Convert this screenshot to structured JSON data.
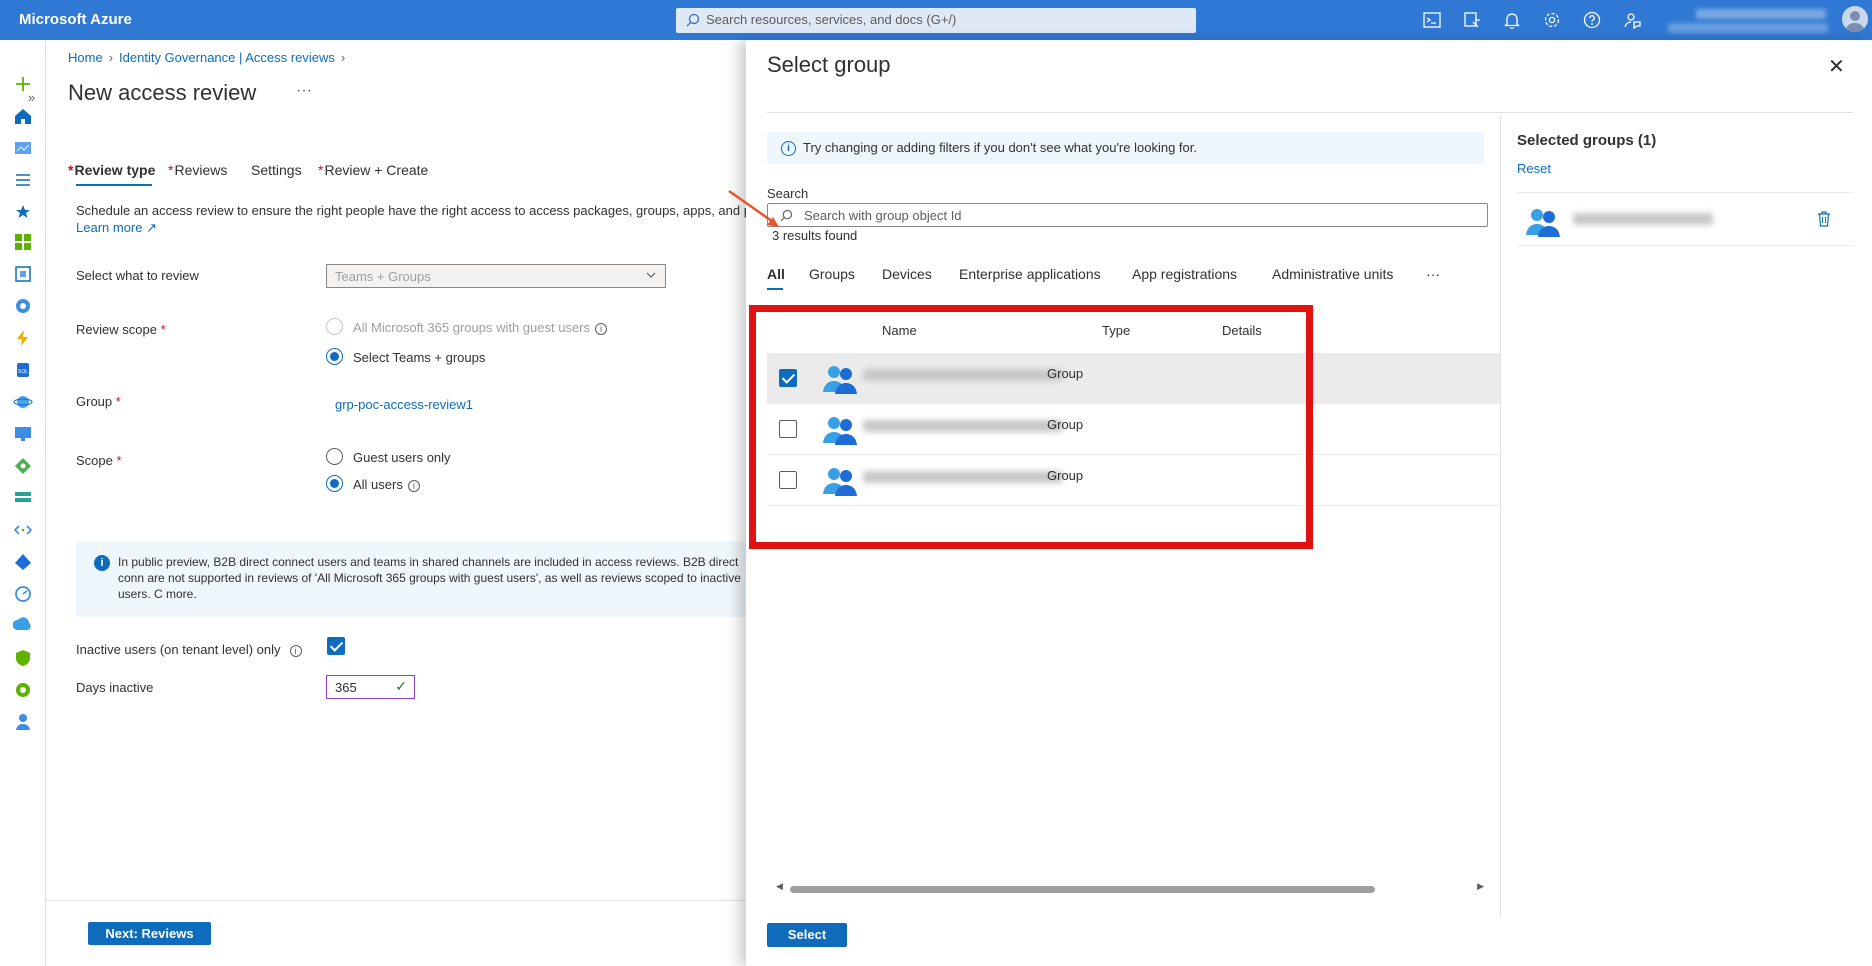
{
  "topbar": {
    "brand": "Microsoft Azure",
    "search_placeholder": "Search resources, services, and docs (G+/)",
    "icons": [
      "cloud-shell-icon",
      "directory-filter-icon",
      "notifications-icon",
      "settings-icon",
      "help-icon",
      "feedback-icon"
    ]
  },
  "breadcrumb": {
    "home": "Home",
    "parent": "Identity Governance | Access reviews"
  },
  "page": {
    "title": "New access review",
    "more": "···"
  },
  "tabs": [
    {
      "label": "Review type",
      "required": "*"
    },
    {
      "label": "Reviews",
      "required": "*"
    },
    {
      "label": "Settings",
      "required": ""
    },
    {
      "label": "Review + Create",
      "required": "*"
    }
  ],
  "form": {
    "description": "Schedule an access review to ensure the right people have the right access to access packages, groups, apps, and priv",
    "learn_more": "Learn more",
    "select_label": "Select what to review",
    "select_value": "Teams + Groups",
    "scope_label": "Review scope",
    "required_mark": "*",
    "scope_opt1": "All Microsoft 365 groups with guest users",
    "scope_opt2": "Select Teams + groups",
    "group_label": "Group",
    "group_value": "grp-poc-access-review1",
    "users_scope_label": "Scope",
    "users_opt1": "Guest users only",
    "users_opt2": "All users",
    "info_text": "In public preview, B2B direct connect users and teams in shared channels are included in access reviews. B2B direct conn are not supported in reviews of 'All Microsoft 365 groups with guest users', as well as reviews scoped to inactive users. C more.",
    "inactive_label": "Inactive users (on tenant level) only",
    "days_label": "Days inactive",
    "days_value": "365",
    "next_button": "Next: Reviews"
  },
  "flyout": {
    "title": "Select group",
    "info": "Try changing or adding filters if you don't see what you're looking for.",
    "search_label": "Search",
    "search_placeholder": "Search with group object Id",
    "results": "3 results found",
    "tabs": [
      "All",
      "Groups",
      "Devices",
      "Enterprise applications",
      "App registrations",
      "Administrative units",
      "···"
    ],
    "columns": {
      "name": "Name",
      "type": "Type",
      "details": "Details"
    },
    "rows": [
      {
        "type": "Group",
        "selected": true
      },
      {
        "type": "Group",
        "selected": false
      },
      {
        "type": "Group",
        "selected": false
      }
    ],
    "selected_title": "Selected groups (1)",
    "reset": "Reset",
    "select_button": "Select"
  },
  "colors": {
    "accent": "#0f6cbd",
    "topbar": "#2f79d4",
    "highlight": "#e01212"
  }
}
